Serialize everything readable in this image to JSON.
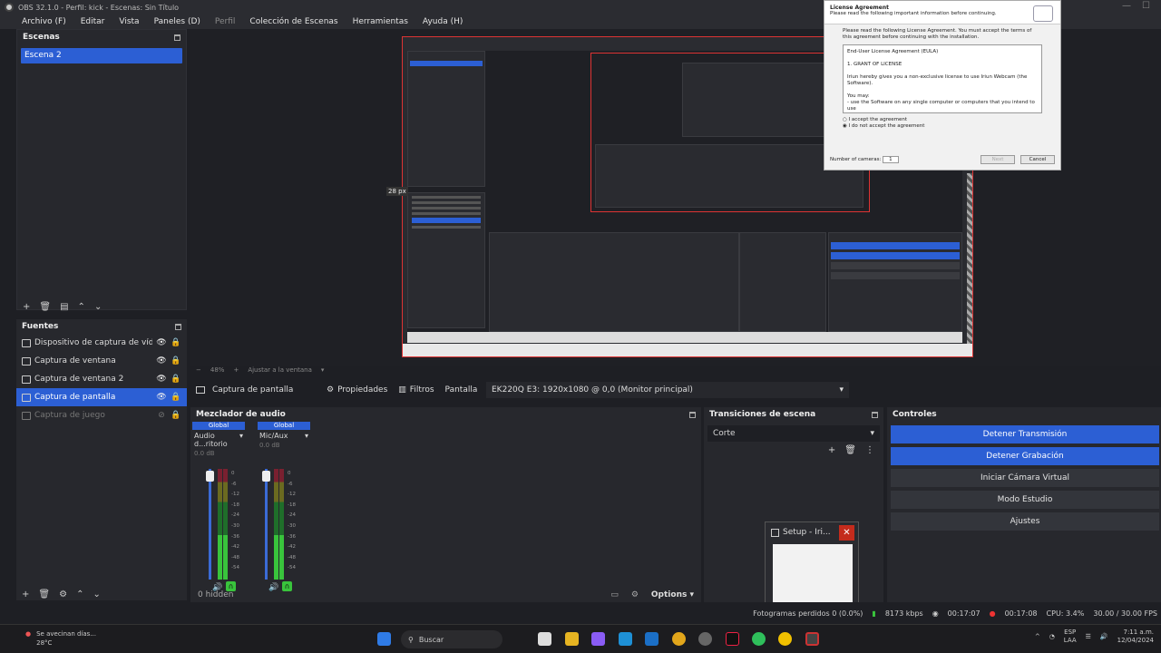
{
  "window": {
    "title": "OBS 32.1.0 - Perfil: kick - Escenas: Sin Título"
  },
  "menu": [
    {
      "label": "Archivo (F)"
    },
    {
      "label": "Editar"
    },
    {
      "label": "Vista"
    },
    {
      "label": "Paneles (D)"
    },
    {
      "label": "Perfil",
      "dim": true
    },
    {
      "label": "Colección de Escenas"
    },
    {
      "label": "Herramientas"
    },
    {
      "label": "Ayuda (H)"
    }
  ],
  "scenes": {
    "title": "Escenas",
    "items": [
      "Escena 2"
    ]
  },
  "sources": {
    "title": "Fuentes",
    "items": [
      {
        "label": "Dispositivo de captura de vídeo",
        "icon": "camera-icon"
      },
      {
        "label": "Captura de ventana",
        "icon": "window-icon"
      },
      {
        "label": "Captura de ventana 2",
        "icon": "window-icon"
      },
      {
        "label": "Captura de pantalla",
        "icon": "monitor-icon"
      },
      {
        "label": "Captura de juego",
        "icon": "gamepad-icon"
      }
    ]
  },
  "preview": {
    "px_label": "28 px",
    "zoom": "48%",
    "fit_label": "Ajustar a la ventana"
  },
  "dialog": {
    "title": "License Agreement",
    "subtitle": "Please read the following important information before continuing.",
    "intro": "Please read the following License Agreement. You must accept the terms of this agreement before continuing with the installation.",
    "doc_title": "End-User License Agreement (EULA)",
    "section": "1. GRANT OF LICENSE",
    "grant": "Iriun hereby gives you a non-exclusive license to use Iriun Webcam (the Software).",
    "may": "You may:",
    "use": "- use the Software on any single computer or computers that you intend to use",
    "accept": "I accept the agreement",
    "decline": "I do not accept the agreement",
    "cameras_label": "Number of cameras:",
    "cameras_value": "1",
    "next": "Next",
    "cancel": "Cancel"
  },
  "context_bar": {
    "source": "Captura de pantalla",
    "properties": "Propiedades",
    "filters": "Filtros",
    "display_label": "Pantalla",
    "display_value": "EK220Q E3: 1920x1080 @ 0,0 (Monitor principal)"
  },
  "mixer": {
    "title": "Mezclador de audio",
    "channels": [
      {
        "global": "Global",
        "name": "Audio d...ritorio",
        "db": "0.0 dB"
      },
      {
        "global": "Global",
        "name": "Mic/Aux",
        "db": "0.0 dB"
      }
    ],
    "scale": [
      "0",
      "-6",
      "-12",
      "-18",
      "-24",
      "-30",
      "-36",
      "-42",
      "-48",
      "-54",
      "-60"
    ],
    "hidden": "0 hidden",
    "options": "Options"
  },
  "transitions": {
    "title": "Transiciones de escena",
    "value": "Corte"
  },
  "controls": {
    "title": "Controles",
    "buttons": [
      {
        "label": "Detener Transmisión",
        "active": true
      },
      {
        "label": "Detener Grabación",
        "active": true
      },
      {
        "label": "Iniciar Cámara Virtual",
        "active": false
      },
      {
        "label": "Modo Estudio",
        "active": false
      },
      {
        "label": "Ajustes",
        "active": false
      }
    ]
  },
  "thumbnail": {
    "title": "Setup - Iri..."
  },
  "status": {
    "dropped": "Fotogramas perdidos 0 (0.0%)",
    "bitrate": "8173 kbps",
    "stream_time": "00:17:07",
    "rec_time": "00:17:08",
    "cpu": "CPU: 3.4%",
    "fps": "30.00 / 30.00 FPS"
  },
  "taskbar": {
    "weather_title": "Se avecinan días...",
    "weather_temp": "28°C",
    "search": "Buscar",
    "lang": "ESP",
    "lang2": "LAA",
    "time": "7:11 a.m.",
    "date": "12/04/2024"
  }
}
